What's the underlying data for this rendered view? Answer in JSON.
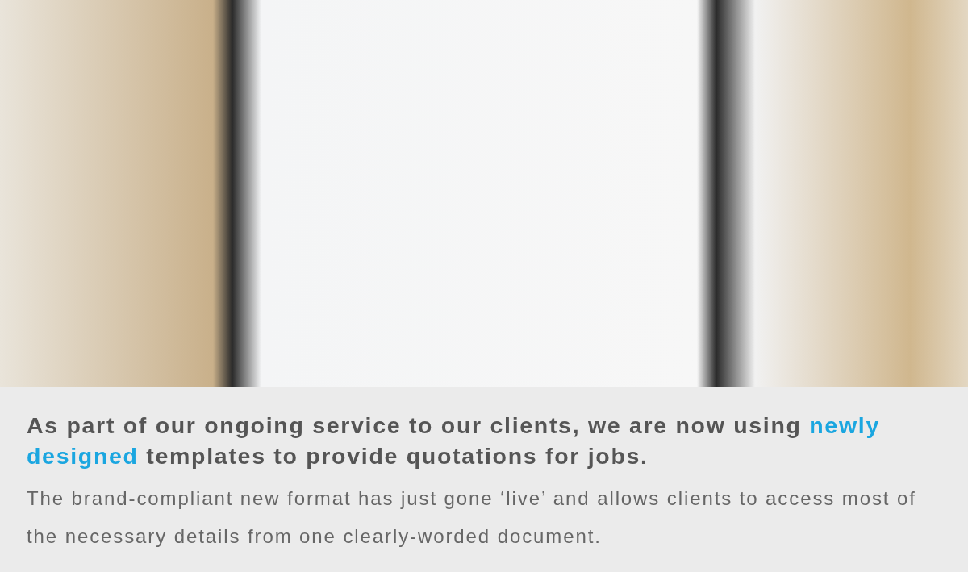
{
  "intro": {
    "headline": [
      {
        "text": "As part of our ongoing service to our clients, we are now using ",
        "highlight": false
      },
      {
        "text": "newly designed",
        "highlight": true
      },
      {
        "text": " templates to provide quotations for jobs.",
        "highlight": false
      }
    ],
    "body": "The brand-compliant new format has just gone ‘live’ and allows clients to access most of the necessary details from one clearly-worded document."
  }
}
